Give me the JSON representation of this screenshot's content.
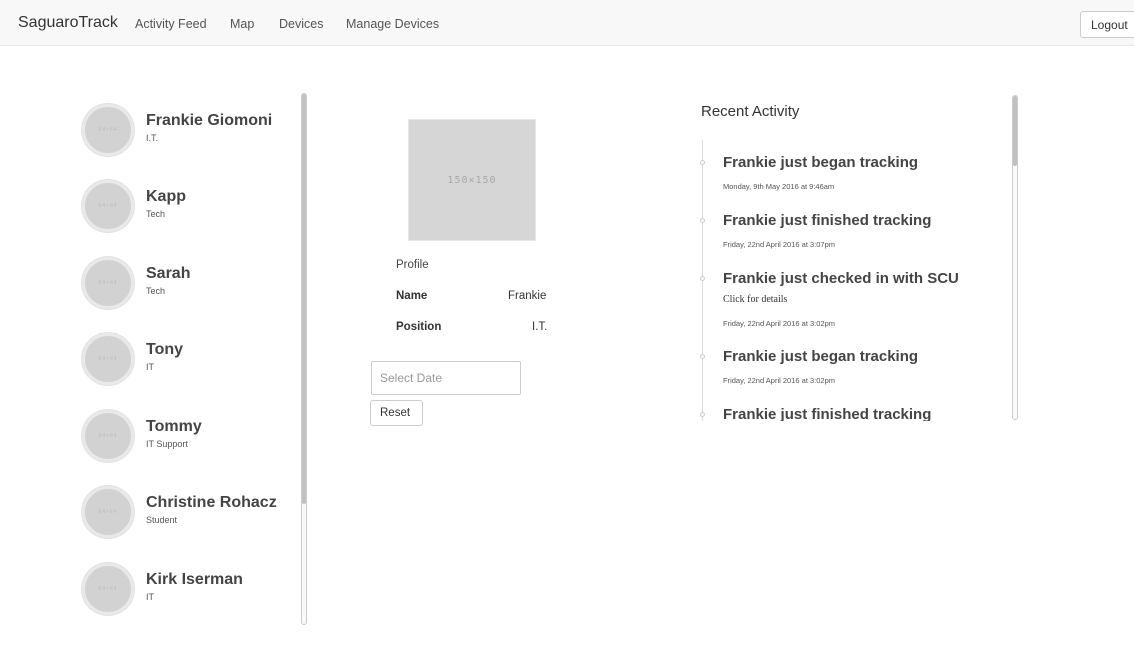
{
  "nav": {
    "brand": "SaguaroTrack",
    "links": [
      "Activity Feed",
      "Map",
      "Devices",
      "Manage Devices"
    ],
    "logout_label": "Logout"
  },
  "users": [
    {
      "name": "Frankie Giomoni",
      "role": "I.T.",
      "avatar_text": "64×64"
    },
    {
      "name": "Kapp",
      "role": "Tech",
      "avatar_text": "64×64"
    },
    {
      "name": "Sarah",
      "role": "Tech",
      "avatar_text": "64×64"
    },
    {
      "name": "Tony",
      "role": "IT",
      "avatar_text": "64×64"
    },
    {
      "name": "Tommy",
      "role": "IT Support",
      "avatar_text": "64×64"
    },
    {
      "name": "Christine Rohacz",
      "role": "Student",
      "avatar_text": "64×64"
    },
    {
      "name": "Kirk Iserman",
      "role": "IT",
      "avatar_text": "64×64"
    }
  ],
  "profile": {
    "image_text": "150×150",
    "title": "Profile",
    "fields": [
      {
        "label": "Name",
        "value": "Frankie"
      },
      {
        "label": "Position",
        "value": "I.T."
      }
    ],
    "date_placeholder": "Select Date",
    "reset_label": "Reset"
  },
  "activity": {
    "title": "Recent Activity",
    "items": [
      {
        "heading": "Frankie just began tracking",
        "detail": "",
        "time": "Monday, 9th May 2016 at 9:46am"
      },
      {
        "heading": "Frankie just finished tracking",
        "detail": "",
        "time": "Friday, 22nd April 2016 at 3:07pm"
      },
      {
        "heading": "Frankie just checked in with SCU",
        "detail": "Click for details",
        "time": "Friday, 22nd April 2016 at 3:02pm"
      },
      {
        "heading": "Frankie just began tracking",
        "detail": "",
        "time": "Friday, 22nd April 2016 at 3:02pm"
      },
      {
        "heading": "Frankie just finished tracking",
        "detail": "",
        "time": ""
      }
    ]
  }
}
